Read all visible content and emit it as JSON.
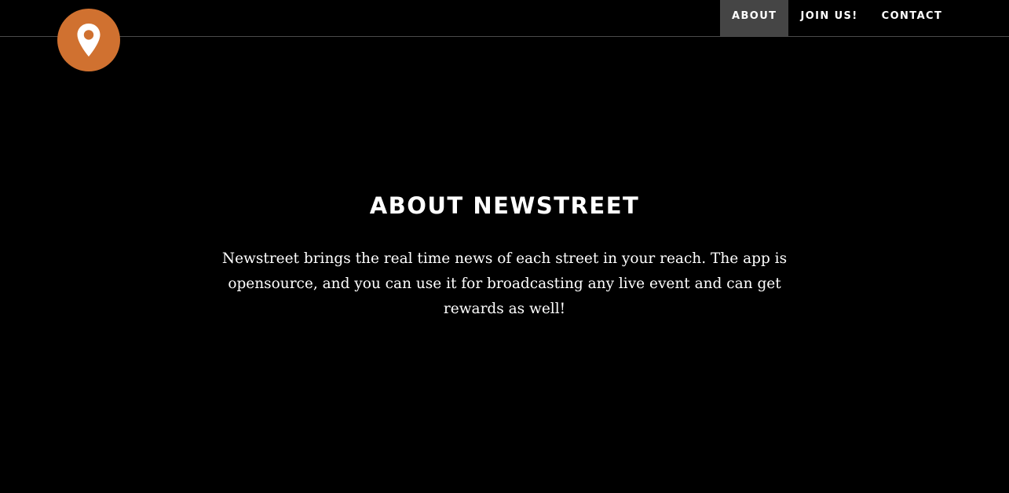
{
  "logo": {
    "icon": "map-pin-icon",
    "color": "#d07130"
  },
  "nav": {
    "items": [
      {
        "label": "ABOUT",
        "active": true
      },
      {
        "label": "JOIN US!",
        "active": false
      },
      {
        "label": "CONTACT",
        "active": false
      }
    ],
    "active_background": "#454545"
  },
  "about": {
    "title": "ABOUT NEWSTREET",
    "text": "Newstreet brings the real time news of each street in your reach. The app is opensource, and you can use it for broadcasting any live event and can get rewards as well!"
  },
  "colors": {
    "background": "#000000",
    "text": "#ffffff",
    "divider": "#4a4a4a"
  }
}
